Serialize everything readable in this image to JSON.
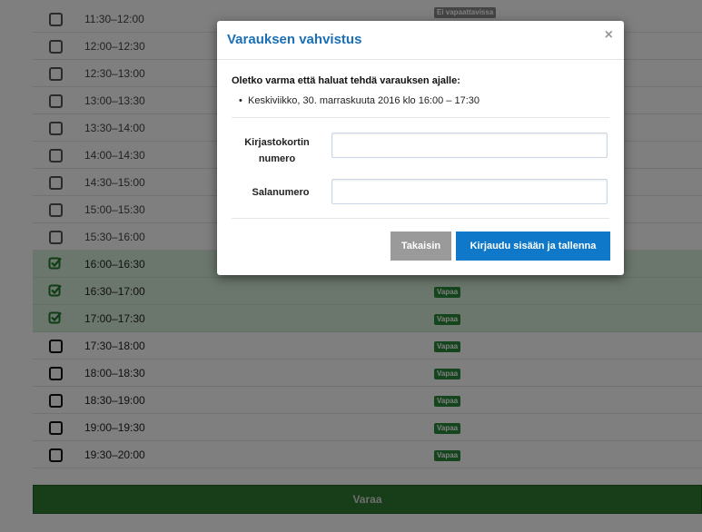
{
  "slots": [
    {
      "time": "11:30–12:00",
      "state": "past",
      "badge": "Ei vapaattavissa",
      "badge_type": "taken"
    },
    {
      "time": "12:00–12:30",
      "state": "past",
      "badge": "",
      "badge_type": ""
    },
    {
      "time": "12:30–13:00",
      "state": "past",
      "badge": "",
      "badge_type": ""
    },
    {
      "time": "13:00–13:30",
      "state": "past",
      "badge": "",
      "badge_type": ""
    },
    {
      "time": "13:30–14:00",
      "state": "past",
      "badge": "",
      "badge_type": ""
    },
    {
      "time": "14:00–14:30",
      "state": "past",
      "badge": "",
      "badge_type": ""
    },
    {
      "time": "14:30–15:00",
      "state": "past",
      "badge": "",
      "badge_type": ""
    },
    {
      "time": "15:00–15:30",
      "state": "past",
      "badge": "",
      "badge_type": ""
    },
    {
      "time": "15:30–16:00",
      "state": "past",
      "badge": "",
      "badge_type": ""
    },
    {
      "time": "16:00–16:30",
      "state": "selected",
      "badge": "",
      "badge_type": ""
    },
    {
      "time": "16:30–17:00",
      "state": "selected",
      "badge": "Vapaa",
      "badge_type": "free"
    },
    {
      "time": "17:00–17:30",
      "state": "selected",
      "badge": "Vapaa",
      "badge_type": "free"
    },
    {
      "time": "17:30–18:00",
      "state": "free",
      "badge": "Vapaa",
      "badge_type": "free"
    },
    {
      "time": "18:00–18:30",
      "state": "free",
      "badge": "Vapaa",
      "badge_type": "free"
    },
    {
      "time": "18:30–19:00",
      "state": "free",
      "badge": "Vapaa",
      "badge_type": "free"
    },
    {
      "time": "19:00–19:30",
      "state": "free",
      "badge": "Vapaa",
      "badge_type": "free"
    },
    {
      "time": "19:30–20:00",
      "state": "free",
      "badge": "Vapaa",
      "badge_type": "free"
    }
  ],
  "reserve_button": "Varaa",
  "modal": {
    "title": "Varauksen vahvistus",
    "close": "×",
    "question": "Oletko varma että haluat tehdä varauksen ajalle:",
    "slot_text": "Keskiviikko, 30. marraskuuta 2016 klo 16:00 – 17:30",
    "bullet": "•",
    "card_label_1": "Kirjastokortin",
    "card_label_2": "numero",
    "pin_label": "Salanumero",
    "card_value": "",
    "pin_value": "",
    "back_button": "Takaisin",
    "login_button": "Kirjaudu sisään ja tallenna"
  },
  "colors": {
    "selected_row": "#d7eed8",
    "free_badge": "#2a8a3a",
    "primary": "#0f78c8",
    "title": "#1a6fb5",
    "reserve": "#2e7d32"
  }
}
